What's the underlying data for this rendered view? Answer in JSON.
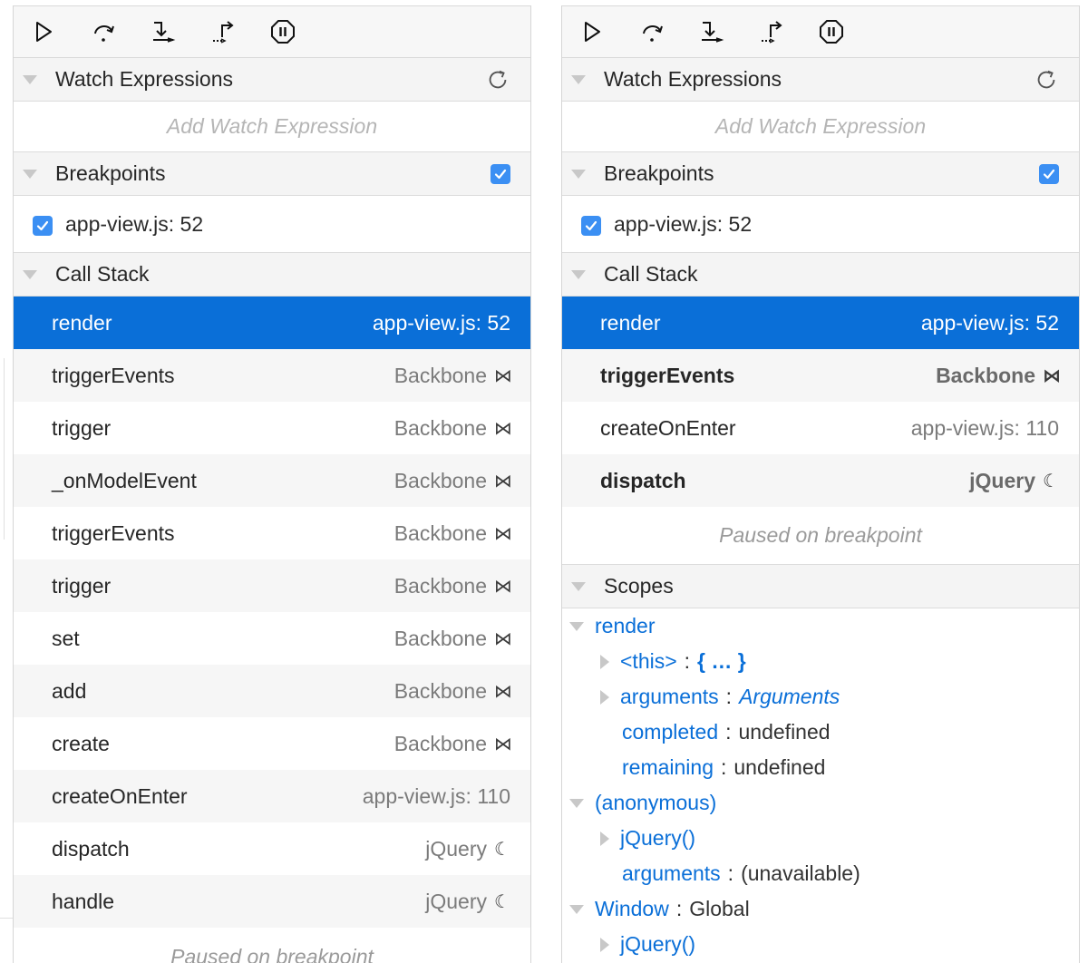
{
  "left": {
    "watch_title": "Watch Expressions",
    "watch_placeholder": "Add Watch Expression",
    "breakpoints_title": "Breakpoints",
    "breakpoint_label": "app-view.js: 52",
    "callstack_title": "Call Stack",
    "frames": [
      {
        "fn": "render",
        "loc": "app-view.js: 52",
        "icon": ""
      },
      {
        "fn": "triggerEvents",
        "loc": "Backbone",
        "icon": "⋈"
      },
      {
        "fn": "trigger",
        "loc": "Backbone",
        "icon": "⋈"
      },
      {
        "fn": "_onModelEvent",
        "loc": "Backbone",
        "icon": "⋈"
      },
      {
        "fn": "triggerEvents",
        "loc": "Backbone",
        "icon": "⋈"
      },
      {
        "fn": "trigger",
        "loc": "Backbone",
        "icon": "⋈"
      },
      {
        "fn": "set",
        "loc": "Backbone",
        "icon": "⋈"
      },
      {
        "fn": "add",
        "loc": "Backbone",
        "icon": "⋈"
      },
      {
        "fn": "create",
        "loc": "Backbone",
        "icon": "⋈"
      },
      {
        "fn": "createOnEnter",
        "loc": "app-view.js: 110",
        "icon": ""
      },
      {
        "fn": "dispatch",
        "loc": "jQuery",
        "icon": "☾"
      },
      {
        "fn": "handle",
        "loc": "jQuery",
        "icon": "☾"
      }
    ],
    "paused_text": "Paused on breakpoint"
  },
  "right": {
    "watch_title": "Watch Expressions",
    "watch_placeholder": "Add Watch Expression",
    "breakpoints_title": "Breakpoints",
    "breakpoint_label": "app-view.js: 52",
    "callstack_title": "Call Stack",
    "frames": [
      {
        "fn": "render",
        "loc": "app-view.js: 52",
        "icon": ""
      },
      {
        "fn": "triggerEvents",
        "loc": "Backbone",
        "icon": "⋈"
      },
      {
        "fn": "createOnEnter",
        "loc": "app-view.js: 110",
        "icon": ""
      },
      {
        "fn": "dispatch",
        "loc": "jQuery",
        "icon": "☾"
      }
    ],
    "paused_text": "Paused on breakpoint",
    "scopes_title": "Scopes",
    "scopes": {
      "render": {
        "name": "render",
        "this_key": "<this>",
        "this_val": "{ … }",
        "arguments_key": "arguments",
        "arguments_val": "Arguments",
        "completed_key": "completed",
        "completed_val": "undefined",
        "remaining_key": "remaining",
        "remaining_val": "undefined"
      },
      "anonymous": {
        "name": "(anonymous)",
        "jquery_key": "jQuery()",
        "arguments_key": "arguments",
        "arguments_val": "(unavailable)"
      },
      "window": {
        "name": "Window",
        "type": "Global",
        "jquery_key": "jQuery()"
      }
    }
  },
  "colors": {
    "accent": "#0a6fd8",
    "checkbox": "#3b8ff3",
    "placeholder": "#b5b5b5"
  },
  "icons": {
    "toolbar": [
      "play-icon",
      "step-over-icon",
      "step-into-icon",
      "step-out-icon",
      "pause-icon"
    ],
    "refresh": "refresh-icon",
    "backbone": "backbone-icon",
    "jquery": "jquery-icon"
  }
}
